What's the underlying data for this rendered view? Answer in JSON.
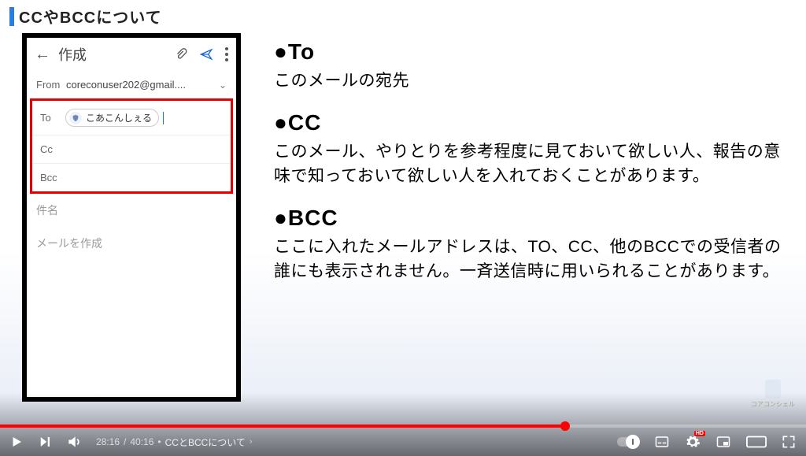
{
  "slide": {
    "title": "CCやBCCについて",
    "sections": {
      "to": {
        "heading": "●To",
        "body": "このメールの宛先"
      },
      "cc": {
        "heading": "●CC",
        "body": "このメール、やりとりを参考程度に見ておいて欲しい人、報告の意味で知っておいて欲しい人を入れておくことがあります。"
      },
      "bcc": {
        "heading": "●BCC",
        "body": "ここに入れたメールアドレスは、TO、CC、他のBCCでの受信者の誰にも表示されません。一斉送信時に用いられることがあります。"
      }
    },
    "logo_text": "コアコンシェル"
  },
  "phone": {
    "header_title": "作成",
    "from_label": "From",
    "from_value": "coreconuser202@gmail....",
    "to_label": "To",
    "to_chip": "こあこんしぇる",
    "cc_label": "Cc",
    "bcc_label": "Bcc",
    "subject_placeholder": "件名",
    "body_placeholder": "メールを作成"
  },
  "player": {
    "current_time": "28:16",
    "duration": "40:16",
    "separator_dot": "•",
    "chapter": "CCとBCCについて",
    "chapter_caret": "›",
    "progress_percent": 70.1,
    "hd_label": "HD"
  }
}
